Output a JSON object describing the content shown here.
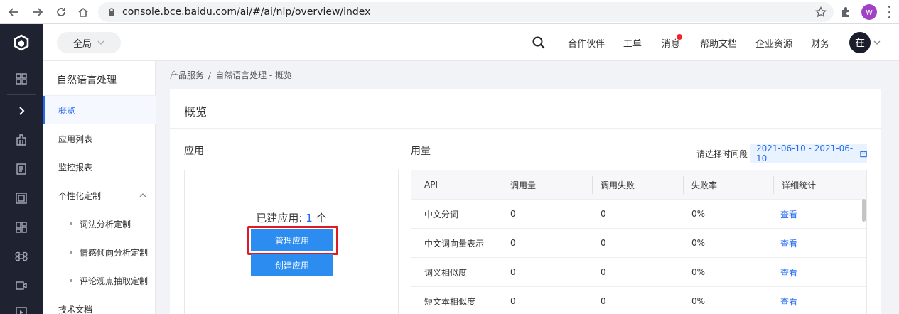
{
  "browser": {
    "url": "console.bce.baidu.com/ai/#/ai/nlp/overview/index",
    "profile_initial": "w"
  },
  "header": {
    "scope_label": "全局",
    "nav": [
      "合作伙伴",
      "工单",
      "消息",
      "帮助文档",
      "企业资源",
      "财务"
    ],
    "avatar_text": "在"
  },
  "sidebar": {
    "title": "自然语言处理",
    "items": [
      {
        "label": "概览",
        "active": true
      },
      {
        "label": "应用列表"
      },
      {
        "label": "监控报表"
      },
      {
        "label": "个性化定制",
        "group": true
      },
      {
        "label": "词法分析定制",
        "sub": true
      },
      {
        "label": "情感倾向分析定制",
        "sub": true
      },
      {
        "label": "评论观点抽取定制",
        "sub": true
      },
      {
        "label": "技术文档"
      }
    ]
  },
  "breadcrumb": [
    "产品服务",
    "/",
    "自然语言处理 - 概览"
  ],
  "main": {
    "title": "概览",
    "app_section": {
      "label": "应用",
      "count_prefix": "已建应用: ",
      "count": "1",
      "count_suffix": " 个",
      "manage_button": "管理应用",
      "create_button": "创建应用"
    },
    "usage_section": {
      "label": "用量",
      "date_label": "请选择时间段",
      "date_range": "2021-06-10 - 2021-06-10",
      "columns": [
        "API",
        "调用量",
        "调用失败",
        "失败率",
        "详细统计"
      ],
      "rows": [
        [
          "中文分词",
          "0",
          "0",
          "0%",
          "查看"
        ],
        [
          "中文词向量表示",
          "0",
          "0",
          "0%",
          "查看"
        ],
        [
          "词义相似度",
          "0",
          "0",
          "0%",
          "查看"
        ],
        [
          "短文本相似度",
          "0",
          "0",
          "0%",
          "查看"
        ]
      ]
    }
  },
  "colors": {
    "accent": "#2468f2",
    "button": "#2d8cf0",
    "rail": "#1f2230",
    "highlight": "#e01b24"
  }
}
